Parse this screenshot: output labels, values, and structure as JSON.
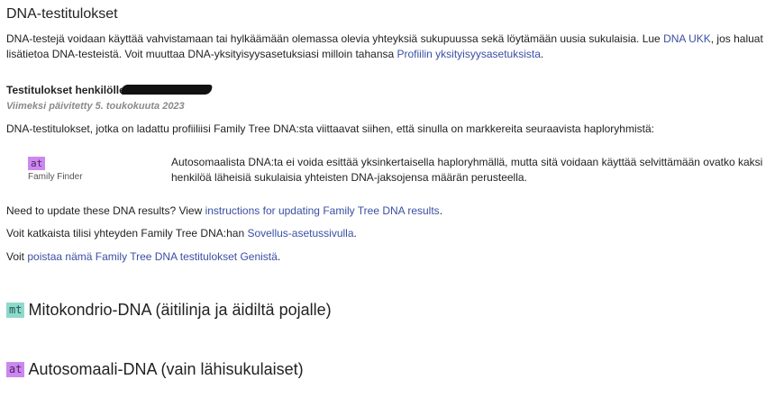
{
  "page": {
    "title": "DNA-testitulokset",
    "intro_before": "DNA-testejä voidaan käyttää vahvistamaan tai hylkäämään olemassa olevia yhteyksiä sukupuussa sekä löytämään uusia sukulaisia. Lue ",
    "intro_link1": "DNA UKK",
    "intro_middle": ", jos haluat lisätietoa DNA-testeistä. Voit muuttaa DNA-yksityisyysasetuksiasi milloin tahansa ",
    "intro_link2": "Profiilin yksityisyysasetuksista",
    "intro_end": "."
  },
  "results": {
    "heading": "Testitulokset henkilölle",
    "updated": "Viimeksi päivitetty 5. toukokuuta 2023",
    "haplogroup_text": "DNA-testitulokset, jotka on ladattu profiiliisi Family Tree DNA:sta viittaavat siihen, että sinulla on markkereita seuraavista haploryhmistä:",
    "tests": [
      {
        "badge": "at",
        "name": "Family Finder",
        "description": "Autosomaalista DNA:ta ei voida esittää yksinkertaisella haploryhmällä, mutta sitä voidaan käyttää selvittämään ovatko kaksi henkilöä läheisiä sukulaisia yhteisten DNA-jaksojensa määrän perusteella."
      }
    ]
  },
  "update_line": {
    "text": "Need to update these DNA results? View ",
    "link": "instructions for updating Family Tree DNA results",
    "end": "."
  },
  "disconnect_line": {
    "text": "Voit katkaista tilisi yhteyden Family Tree DNA:han ",
    "link": "Sovellus-asetussivulla",
    "end": "."
  },
  "remove_line": {
    "text": "Voit ",
    "link": "poistaa nämä Family Tree DNA testitulokset Genistä",
    "end": "."
  },
  "sections": [
    {
      "badge": "mt",
      "title": "Mitokondrio-DNA (äitilinja ja äidiltä pojalle)"
    },
    {
      "badge": "at",
      "title": "Autosomaali-DNA (vain lähisukulaiset)"
    }
  ],
  "colors": {
    "link": "#3a4fa3",
    "badge_at": "#cc88ee",
    "badge_mt": "#8fd9cc"
  }
}
